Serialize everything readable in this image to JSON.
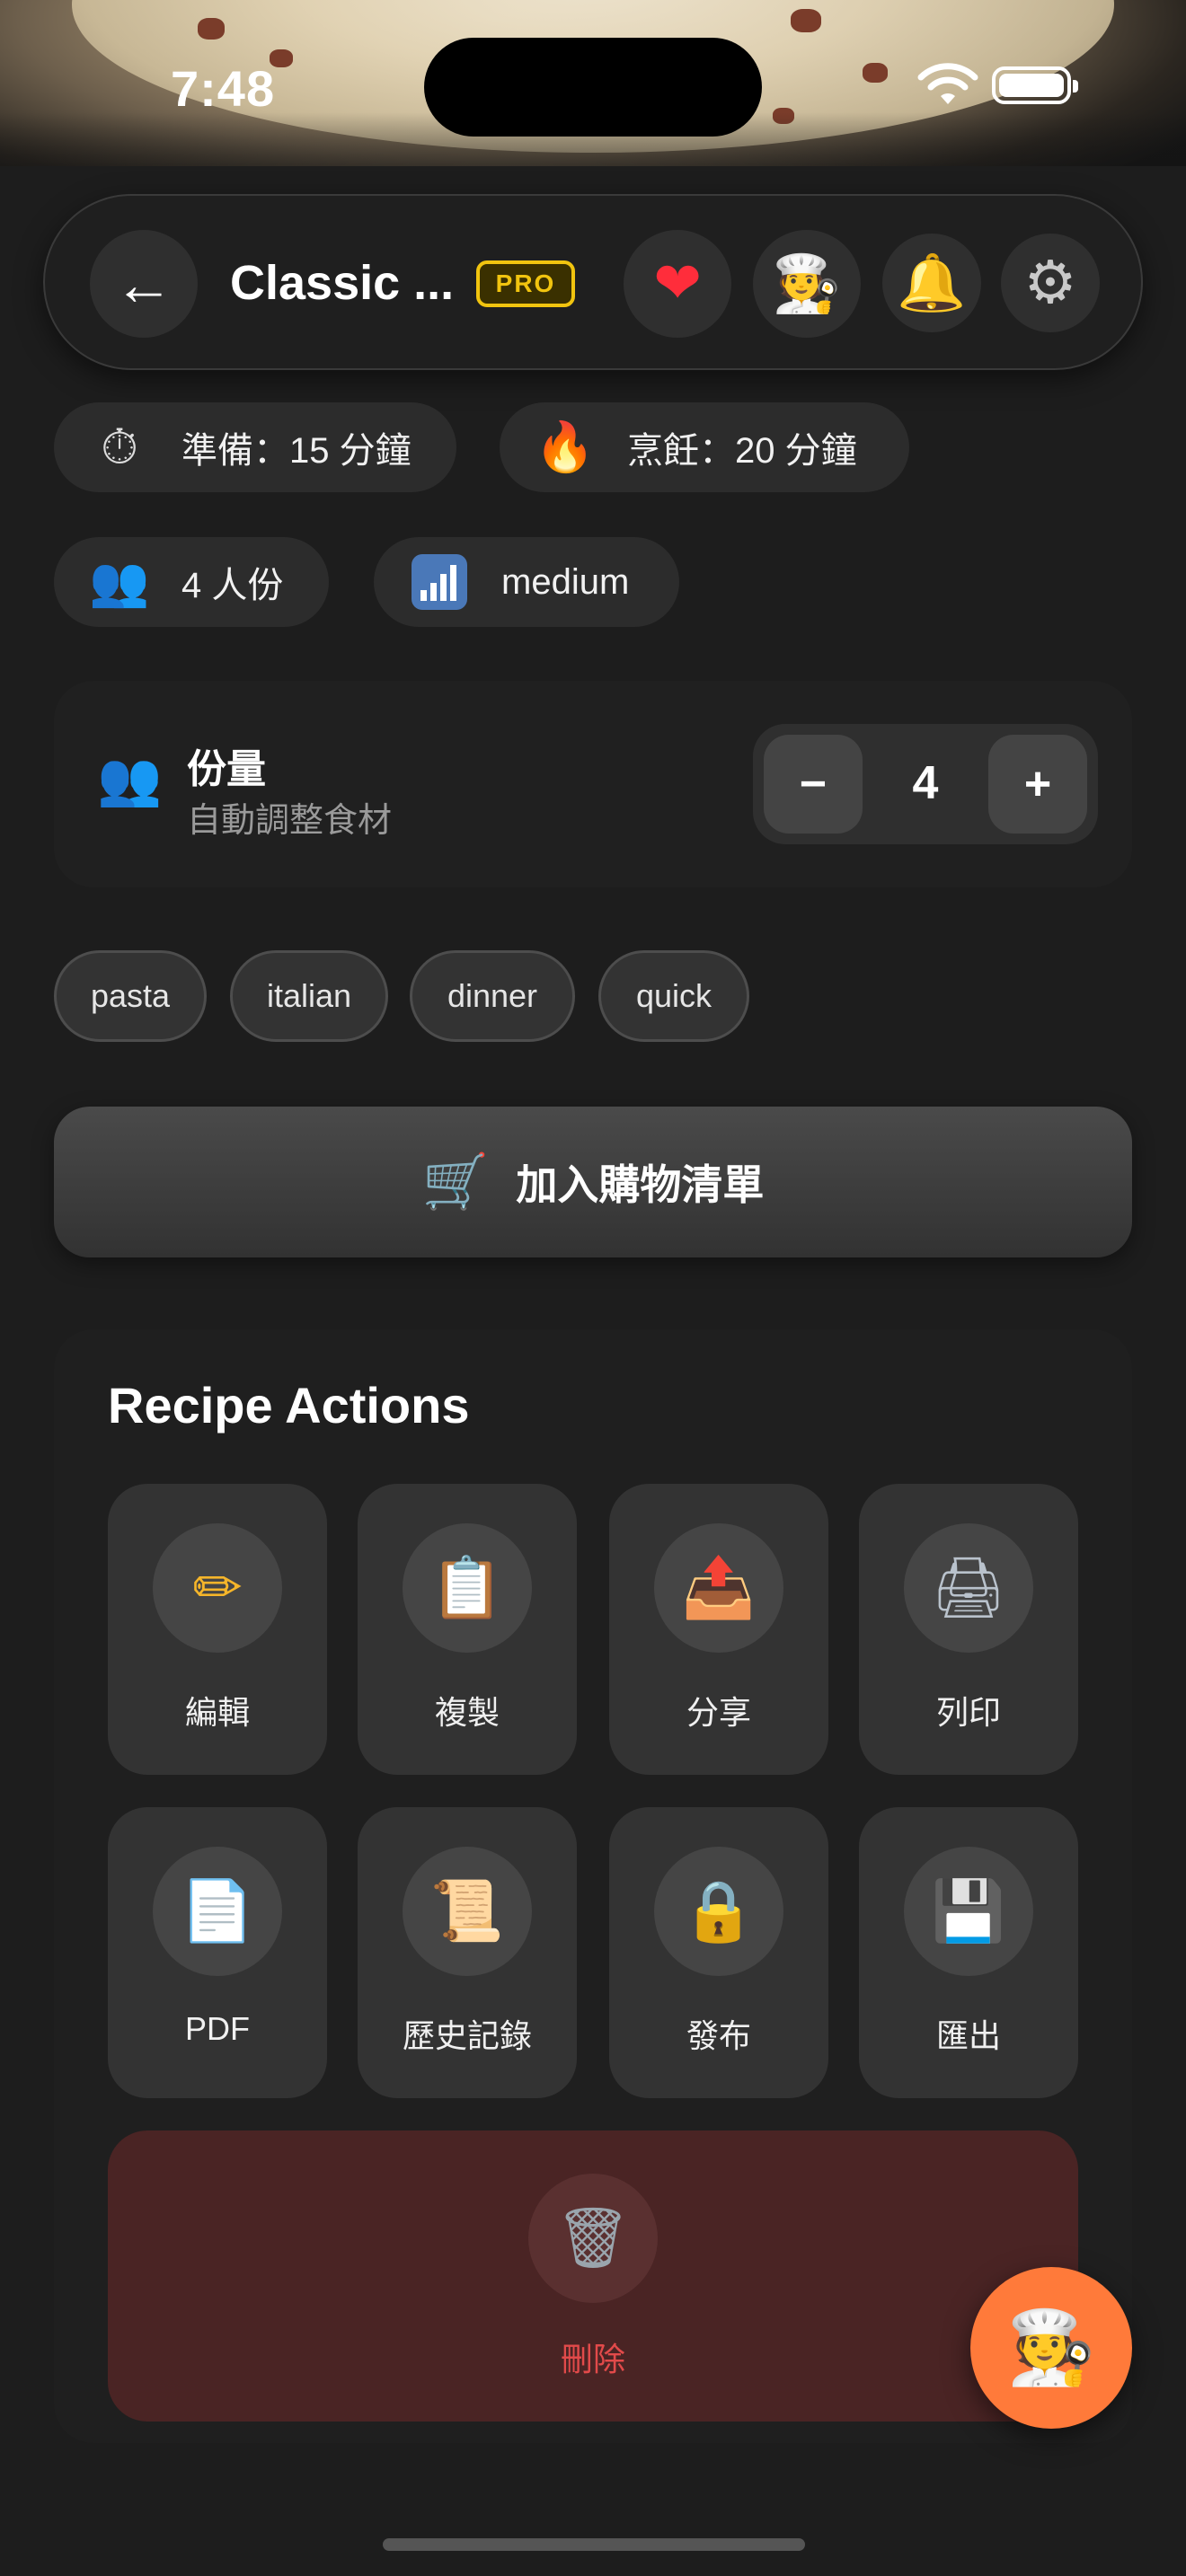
{
  "status_bar": {
    "time": "7:48"
  },
  "header": {
    "title": "Classic ...",
    "badge": "PRO",
    "icons": [
      "back-arrow-icon",
      "heart-icon",
      "chef-icon",
      "bell-icon",
      "gear-icon"
    ]
  },
  "info": {
    "prep": "準備：15 分鐘",
    "cook": "烹飪：20 分鐘",
    "servings": "4 人份",
    "difficulty": "medium"
  },
  "servings_card": {
    "title": "份量",
    "subtitle": "自動調整食材",
    "value": "4",
    "minus": "−",
    "plus": "+"
  },
  "tags": [
    "pasta",
    "italian",
    "dinner",
    "quick"
  ],
  "shopping_button": {
    "label": "加入購物清單"
  },
  "actions": {
    "title": "Recipe Actions",
    "items": [
      {
        "label": "編輯",
        "icon": "pencil-icon"
      },
      {
        "label": "複製",
        "icon": "clipboard-icon"
      },
      {
        "label": "分享",
        "icon": "share-tray-icon"
      },
      {
        "label": "列印",
        "icon": "printer-icon"
      },
      {
        "label": "PDF",
        "icon": "document-icon"
      },
      {
        "label": "歷史記錄",
        "icon": "scroll-icon"
      },
      {
        "label": "發布",
        "icon": "lock-icon"
      },
      {
        "label": "匯出",
        "icon": "floppy-disk-icon"
      }
    ],
    "delete": {
      "label": "刪除",
      "icon": "trash-icon"
    }
  },
  "fab": {
    "icon": "chef-icon"
  },
  "colors": {
    "accent": "#ff7a3a",
    "pro": "#f1c40f",
    "danger": "#e24a4a"
  }
}
